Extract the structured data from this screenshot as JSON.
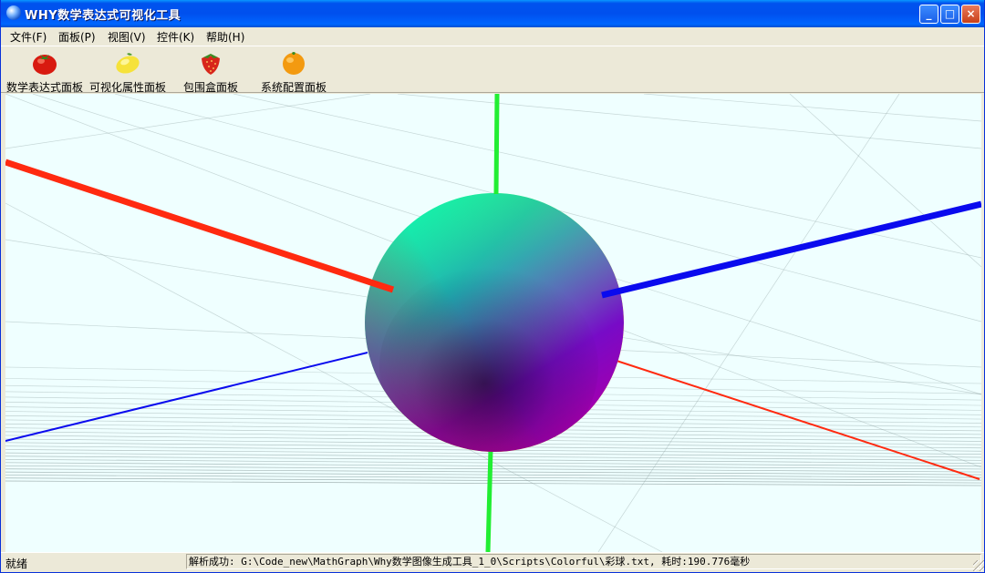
{
  "window": {
    "title": "WHY数学表达式可视化工具"
  },
  "titlebar_buttons": {
    "minimize": "_",
    "maximize": "□",
    "close": "×"
  },
  "menu": [
    "文件(F)",
    "面板(P)",
    "视图(V)",
    "控件(K)",
    "帮助(H)"
  ],
  "toolbar": [
    {
      "label": "数学表达式面板",
      "icon": "tomato-icon"
    },
    {
      "label": "可视化属性面板",
      "icon": "lemon-icon"
    },
    {
      "label": "包围盒面板",
      "icon": "strawberry-icon"
    },
    {
      "label": "系统配置面板",
      "icon": "orange-icon"
    }
  ],
  "status": {
    "left": "就绪",
    "message": "解析成功: G:\\Code_new\\MathGraph\\Why数学图像生成工具_1_0\\Scripts\\Colorful\\彩球.txt, 耗时:190.776毫秒"
  },
  "colors": {
    "x_axis": "#ff2a10",
    "y_axis": "#22ee33",
    "z_axis": "#0a0aee",
    "viewport_bg": "#efffff"
  }
}
